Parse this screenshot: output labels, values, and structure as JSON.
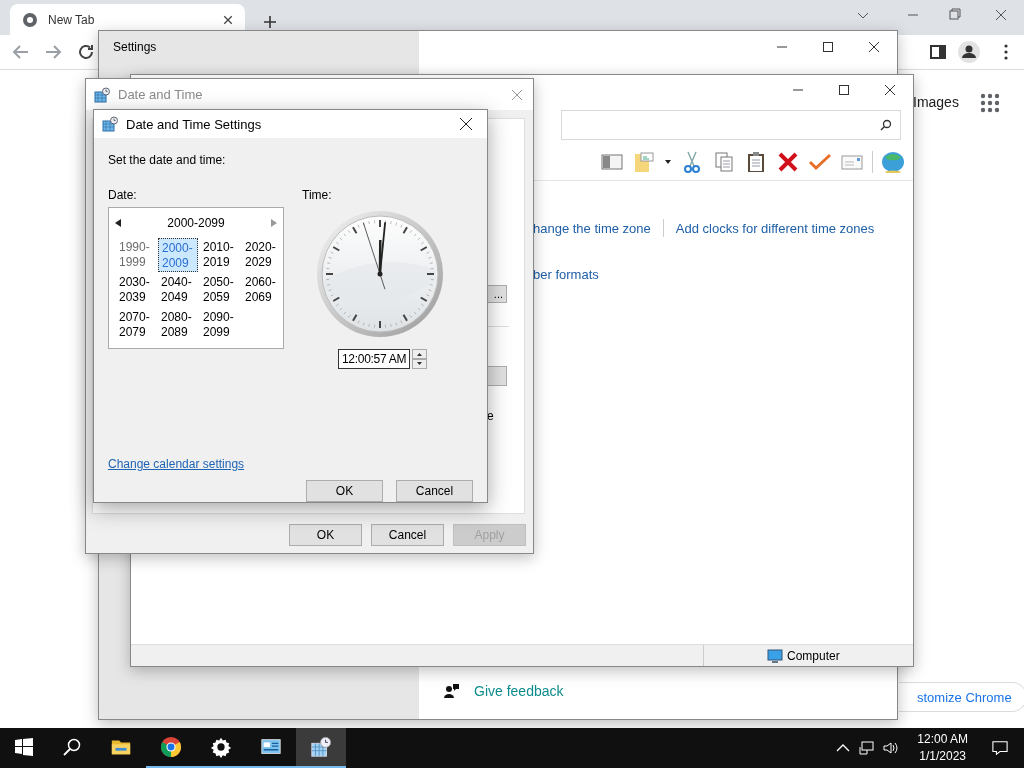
{
  "browser": {
    "tabs": [
      {
        "title": "New Tab",
        "selected": true
      }
    ],
    "header_links": [
      "Images"
    ],
    "customize_button": "stomize Chrome"
  },
  "settings_window": {
    "title": "Settings",
    "feedback_link": "Give feedback"
  },
  "control_panel": {
    "links": [
      "hange the time zone",
      "Add clocks for different time zones",
      "ber formats"
    ],
    "status_bar": {
      "location": "Computer"
    }
  },
  "date_time_window": {
    "title": "Date and Time",
    "active": false,
    "fragment_button": "...",
    "fragment_text": "e",
    "buttons": [
      {
        "label": "OK",
        "disabled": false
      },
      {
        "label": "Cancel",
        "disabled": false
      },
      {
        "label": "Apply",
        "disabled": true
      }
    ]
  },
  "date_time_settings": {
    "title": "Date and Time Settings",
    "active": true,
    "prompt": "Set the date and time:",
    "date_label": "Date:",
    "time_label": "Time:",
    "calendar": {
      "range": "2000-2099",
      "decades": [
        {
          "label": "1990-1999",
          "selected": false,
          "outside": true
        },
        {
          "label": "2000-2009",
          "selected": true,
          "outside": false
        },
        {
          "label": "2010-2019",
          "selected": false,
          "outside": false
        },
        {
          "label": "2020-2029",
          "selected": false,
          "outside": false
        },
        {
          "label": "2030-2039",
          "selected": false,
          "outside": false
        },
        {
          "label": "2040-2049",
          "selected": false,
          "outside": false
        },
        {
          "label": "2050-2059",
          "selected": false,
          "outside": false
        },
        {
          "label": "2060-2069",
          "selected": false,
          "outside": false
        },
        {
          "label": "2070-2079",
          "selected": false,
          "outside": false
        },
        {
          "label": "2080-2089",
          "selected": false,
          "outside": false
        },
        {
          "label": "2090-2099",
          "selected": false,
          "outside": false
        }
      ]
    },
    "time": "12:00:57 AM",
    "calendar_link": "Change calendar settings",
    "buttons": [
      {
        "label": "OK",
        "disabled": false
      },
      {
        "label": "Cancel",
        "disabled": false
      }
    ]
  },
  "taskbar": {
    "apps": [
      {
        "kind": "explorer",
        "running": false,
        "selected": false
      },
      {
        "kind": "chrome",
        "running": true,
        "selected": false
      },
      {
        "kind": "settings",
        "running": true,
        "selected": false
      },
      {
        "kind": "control-panel",
        "running": true,
        "selected": false
      },
      {
        "kind": "date-time",
        "running": true,
        "selected": true
      }
    ],
    "clock": {
      "time": "12:00 AM",
      "date": "1/1/2023"
    }
  }
}
